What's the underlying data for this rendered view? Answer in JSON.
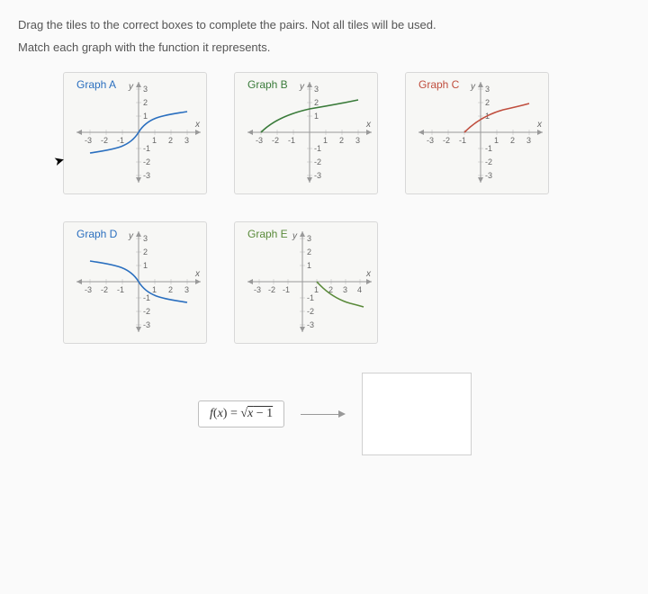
{
  "instructions": {
    "line1": "Drag the tiles to the correct boxes to complete the pairs. Not all tiles will be used.",
    "line2": "Match each graph with the function it represents."
  },
  "graphs": {
    "A": {
      "label": "Graph A"
    },
    "B": {
      "label": "Graph B"
    },
    "C": {
      "label": "Graph C"
    },
    "D": {
      "label": "Graph D"
    },
    "E": {
      "label": "Graph E"
    }
  },
  "axis": {
    "x": "x",
    "y": "y"
  },
  "ticks": {
    "n3": "-3",
    "n2": "-2",
    "n1": "-1",
    "p1": "1",
    "p2": "2",
    "p3": "3",
    "p4": "4"
  },
  "tile": {
    "formula_plain": "f(x) = √(x − 1)"
  },
  "chart_data": [
    {
      "graph": "A",
      "type": "line",
      "xlim": [
        -3.5,
        3.5
      ],
      "ylim": [
        -3.5,
        3.5
      ],
      "series": [
        {
          "name": "cbrt(x)",
          "points": [
            [
              -3,
              -1.44
            ],
            [
              -2,
              -1.26
            ],
            [
              -1,
              -1
            ],
            [
              0,
              0
            ],
            [
              1,
              1
            ],
            [
              2,
              1.26
            ],
            [
              3,
              1.44
            ]
          ]
        }
      ],
      "color": "#2a6fbf"
    },
    {
      "graph": "B",
      "type": "line",
      "xlim": [
        -3.5,
        3.5
      ],
      "ylim": [
        -3.5,
        3.5
      ],
      "series": [
        {
          "name": "sqrt(x+3)",
          "points": [
            [
              -3,
              0
            ],
            [
              -2,
              1
            ],
            [
              -1,
              1.41
            ],
            [
              0,
              1.73
            ],
            [
              1,
              2
            ],
            [
              2,
              2.24
            ],
            [
              3,
              2.45
            ]
          ]
        }
      ],
      "color": "#3a7b3a"
    },
    {
      "graph": "C",
      "type": "line",
      "xlim": [
        -3.5,
        3.5
      ],
      "ylim": [
        -3.5,
        3.5
      ],
      "series": [
        {
          "name": "sqrt(x+1)",
          "points": [
            [
              -1,
              0
            ],
            [
              0,
              1
            ],
            [
              1,
              1.41
            ],
            [
              2,
              1.73
            ],
            [
              3,
              2
            ]
          ]
        }
      ],
      "color": "#c04e3e"
    },
    {
      "graph": "D",
      "type": "line",
      "xlim": [
        -3.5,
        3.5
      ],
      "ylim": [
        -3.5,
        3.5
      ],
      "series": [
        {
          "name": "-cbrt(x)",
          "points": [
            [
              -3,
              1.44
            ],
            [
              -2,
              1.26
            ],
            [
              -1,
              1
            ],
            [
              0,
              0
            ],
            [
              1,
              -1
            ],
            [
              2,
              -1.26
            ],
            [
              3,
              -1.44
            ]
          ]
        }
      ],
      "color": "#2a6fbf"
    },
    {
      "graph": "E",
      "type": "line",
      "xlim": [
        -3.5,
        4.5
      ],
      "ylim": [
        -3.5,
        3.5
      ],
      "series": [
        {
          "name": "-sqrt(x-1)",
          "points": [
            [
              1,
              0
            ],
            [
              2,
              -1
            ],
            [
              3,
              -1.41
            ],
            [
              4,
              -1.73
            ]
          ]
        }
      ],
      "color": "#5a8a3a"
    }
  ]
}
